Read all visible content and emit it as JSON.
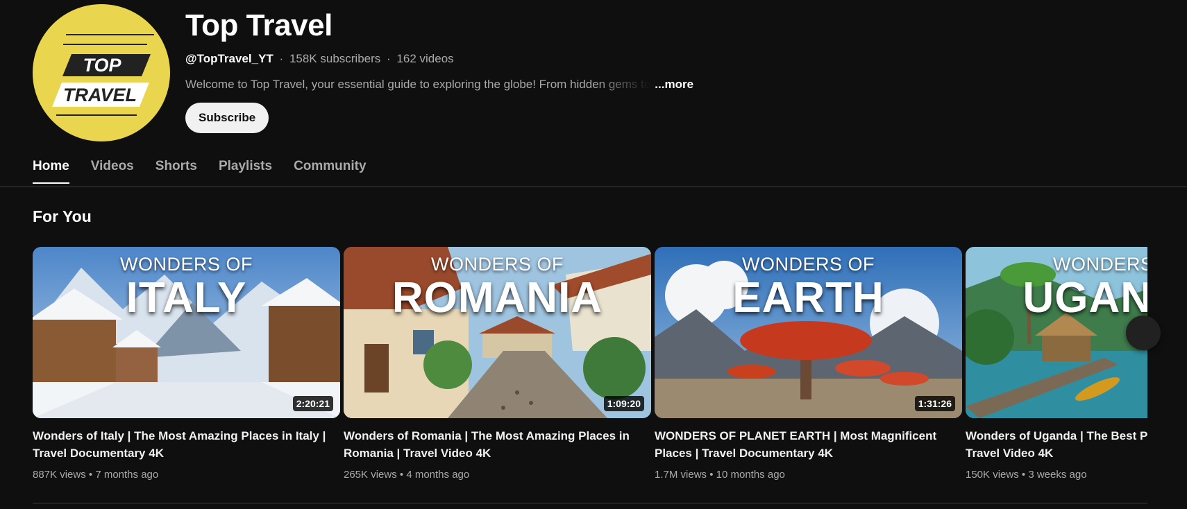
{
  "channel": {
    "name": "Top Travel",
    "logo_text_1": "TOP",
    "logo_text_2": "TRAVEL",
    "handle": "@TopTravel_YT",
    "subscribers": "158K subscribers",
    "videos": "162 videos",
    "separator": "·",
    "description": "Welcome to Top Travel, your essential guide to exploring the globe! From hidden gems to",
    "more_label": "...more",
    "subscribe_label": "Subscribe"
  },
  "tabs": [
    {
      "label": "Home",
      "active": true
    },
    {
      "label": "Videos",
      "active": false
    },
    {
      "label": "Shorts",
      "active": false
    },
    {
      "label": "Playlists",
      "active": false
    },
    {
      "label": "Community",
      "active": false
    }
  ],
  "section": {
    "title": "For You"
  },
  "videos": [
    {
      "thumb_small": "WONDERS OF",
      "thumb_big": "ITALY",
      "duration": "2:20:21",
      "title_line1": "Wonders of Italy | The Most Amazing Places in Italy |",
      "title_line2": "Travel Documentary 4K",
      "views": "887K views",
      "age": "7 months ago",
      "meta_sep": "•"
    },
    {
      "thumb_small": "WONDERS OF",
      "thumb_big": "ROMANIA",
      "duration": "1:09:20",
      "title_line1": "Wonders of Romania | The Most Amazing Places in",
      "title_line2": "Romania | Travel Video 4K",
      "views": "265K views",
      "age": "4 months ago",
      "meta_sep": "•"
    },
    {
      "thumb_small": "WONDERS OF",
      "thumb_big": "EARTH",
      "duration": "1:31:26",
      "title_line1": "WONDERS OF PLANET EARTH | Most Magnificent",
      "title_line2": "Places | Travel Documentary 4K",
      "views": "1.7M views",
      "age": "10 months ago",
      "meta_sep": "•"
    },
    {
      "thumb_small": "WONDERS OF",
      "thumb_big": "UGANDA",
      "duration": "",
      "title_line1": "Wonders of Uganda | The Best Places in Uganda |",
      "title_line2": "Travel Video 4K",
      "views": "150K views",
      "age": "3 weeks ago",
      "meta_sep": "•"
    }
  ],
  "icons": {
    "next_arrow": "chevron-right-icon"
  },
  "colors": {
    "background": "#0f0f0f",
    "logo_yellow": "#ead54e",
    "text_secondary": "#aaaaaa"
  }
}
